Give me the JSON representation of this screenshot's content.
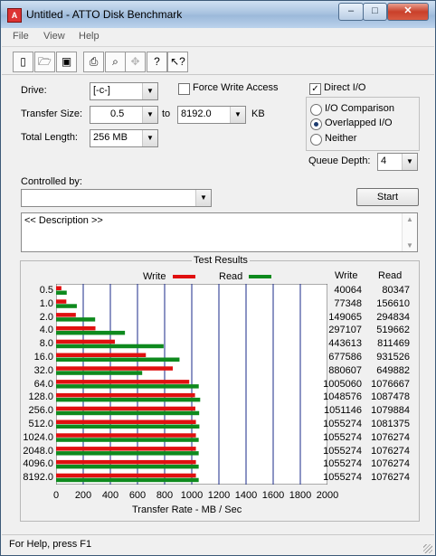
{
  "window": {
    "title": "Untitled - ATTO Disk Benchmark",
    "minimize": "–",
    "maximize": "□",
    "close": "✕"
  },
  "menu": [
    "File",
    "View",
    "Help"
  ],
  "toolbar": {
    "icons": [
      "new-document-icon",
      "open-folder-icon",
      "save-icon",
      "print-icon",
      "print-preview-icon",
      "move-icon",
      "help-icon",
      "whats-this-help-icon"
    ]
  },
  "drive": {
    "label": "Drive:",
    "value": "[-c-]"
  },
  "force_write": {
    "label": "Force Write Access",
    "checked": false
  },
  "direct_io": {
    "label": "Direct I/O",
    "checked": true
  },
  "transfer": {
    "label": "Transfer Size:",
    "from": "0.5",
    "to_label": "to",
    "to": "8192.0",
    "unit": "KB"
  },
  "total_length": {
    "label": "Total Length:",
    "value": "256 MB"
  },
  "io_mode": {
    "options": [
      "I/O Comparison",
      "Overlapped I/O",
      "Neither"
    ],
    "selected": "Overlapped I/O"
  },
  "queue_depth": {
    "label": "Queue Depth:",
    "value": "4"
  },
  "controlled_by": {
    "label": "Controlled by:",
    "value": ""
  },
  "start_label": "Start",
  "description": "<< Description >>",
  "results": {
    "title": "Test Results",
    "write_label": "Write",
    "read_label": "Read",
    "col_write": "Write",
    "col_read": "Read"
  },
  "status": "For Help, press F1",
  "colors": {
    "write": "#e01010",
    "read": "#0e8a1e",
    "grid": "#1a2a8a"
  },
  "chart_data": {
    "type": "bar",
    "orientation": "horizontal",
    "categories": [
      "0.5",
      "1.0",
      "2.0",
      "4.0",
      "8.0",
      "16.0",
      "32.0",
      "64.0",
      "128.0",
      "256.0",
      "512.0",
      "1024.0",
      "2048.0",
      "4096.0",
      "8192.0"
    ],
    "series": [
      {
        "name": "Write",
        "values": [
          40064,
          77348,
          149065,
          297107,
          443613,
          677586,
          880607,
          1005060,
          1048576,
          1051146,
          1055274,
          1055274,
          1055274,
          1055274,
          1055274
        ]
      },
      {
        "name": "Read",
        "values": [
          80347,
          156610,
          294834,
          519662,
          811469,
          931526,
          649882,
          1076667,
          1087478,
          1079884,
          1081375,
          1076274,
          1076274,
          1076274,
          1076274
        ]
      }
    ],
    "xlabel": "Transfer Rate - MB / Sec",
    "xticks": [
      "0",
      "200",
      "400",
      "600",
      "800",
      "1000",
      "1200",
      "1400",
      "1600",
      "1800",
      "2000"
    ],
    "xlim": [
      0,
      2000
    ],
    "grid": true,
    "legend": "top"
  }
}
